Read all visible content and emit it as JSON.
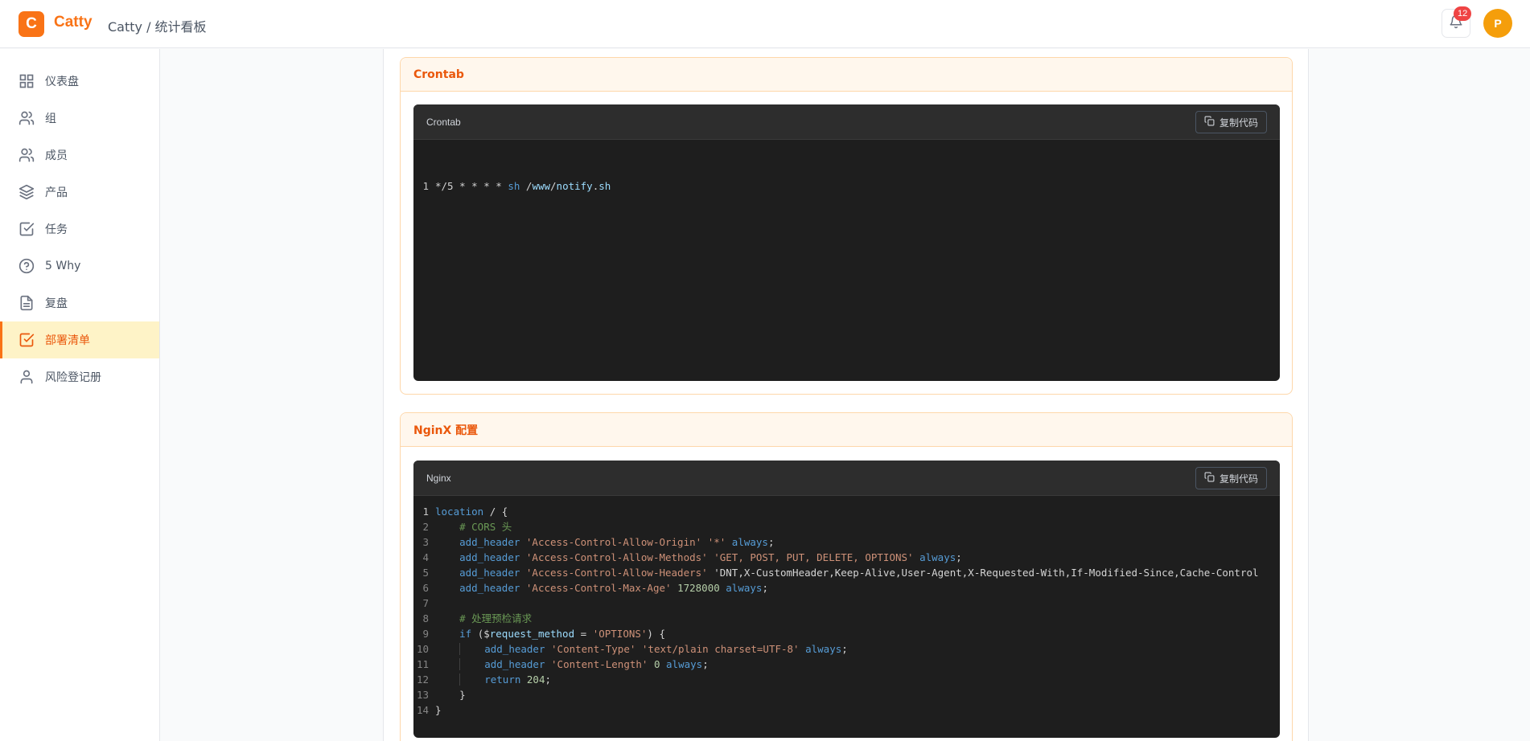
{
  "header": {
    "logo_letter": "C",
    "brand": "Catty",
    "breadcrumb": "Catty / 统计看板",
    "notification_count": "12",
    "avatar_letter": "P"
  },
  "sidebar": {
    "items": [
      {
        "label": "仪表盘",
        "icon": "dashboard-grid-icon"
      },
      {
        "label": "组",
        "icon": "users-icon"
      },
      {
        "label": "成员",
        "icon": "users-icon"
      },
      {
        "label": "产品",
        "icon": "layers-icon"
      },
      {
        "label": "任务",
        "icon": "check-square-icon"
      },
      {
        "label": "5 Why",
        "icon": "help-circle-icon"
      },
      {
        "label": "复盘",
        "icon": "file-text-icon"
      },
      {
        "label": "部署清单",
        "icon": "check-square-icon",
        "active": true
      },
      {
        "label": "风险登记册",
        "icon": "user-icon"
      }
    ]
  },
  "colors": {
    "accent": "#f97316",
    "active_bg": "#fef3c7",
    "code_bg": "#1e1e1e"
  },
  "crontab_card": {
    "title": "Crontab",
    "code_lang": "Crontab",
    "copy_label": "复制代码",
    "lines": [
      "*/5 * * * * sh /www/notify.sh"
    ]
  },
  "nginx_card": {
    "title": "NginX 配置",
    "code_lang": "Nginx",
    "copy_label": "复制代码",
    "lines": [
      "location / {",
      "    # CORS 头",
      "    add_header 'Access-Control-Allow-Origin' '*' always;",
      "    add_header 'Access-Control-Allow-Methods' 'GET, POST, PUT, DELETE, OPTIONS' always;",
      "    add_header 'Access-Control-Allow-Headers' 'DNT,X-CustomHeader,Keep-Alive,User-Agent,X-Requested-With,If-Modified-Since,Cache-Control",
      "    add_header 'Access-Control-Max-Age' 1728000 always;",
      "",
      "    # 处理预检请求",
      "    if ($request_method = 'OPTIONS') {",
      "        add_header 'Content-Type' 'text/plain charset=UTF-8' always;",
      "        add_header 'Content-Length' 0 always;",
      "        return 204;",
      "    }",
      "}"
    ]
  }
}
